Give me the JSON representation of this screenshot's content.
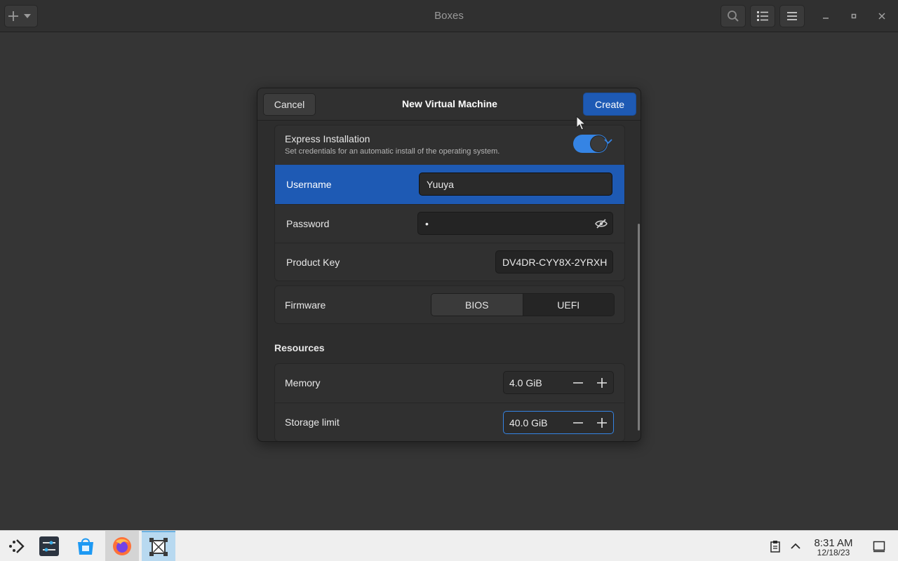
{
  "window": {
    "title": "Boxes"
  },
  "dialog": {
    "title": "New Virtual Machine",
    "cancel_label": "Cancel",
    "create_label": "Create",
    "express": {
      "title": "Express Installation",
      "subtitle": "Set credentials for an automatic install of the operating system.",
      "enabled": true
    },
    "username": {
      "label": "Username",
      "value": "Yuuya"
    },
    "password": {
      "label": "Password",
      "value": "•"
    },
    "product_key": {
      "label": "Product Key",
      "value": "DV4DR-CYY8X-2YRXH"
    },
    "firmware": {
      "label": "Firmware",
      "options": [
        "BIOS",
        "UEFI"
      ],
      "selected": "UEFI"
    },
    "resources": {
      "title": "Resources",
      "memory": {
        "label": "Memory",
        "value": "4.0 GiB"
      },
      "storage": {
        "label": "Storage limit",
        "value": "40.0 GiB"
      }
    }
  },
  "taskbar": {
    "time": "8:31 AM",
    "date": "12/18/23"
  },
  "colors": {
    "accent": "#3584e4",
    "selected_row": "#1e5ab4",
    "create_button": "#1e5ab4"
  }
}
